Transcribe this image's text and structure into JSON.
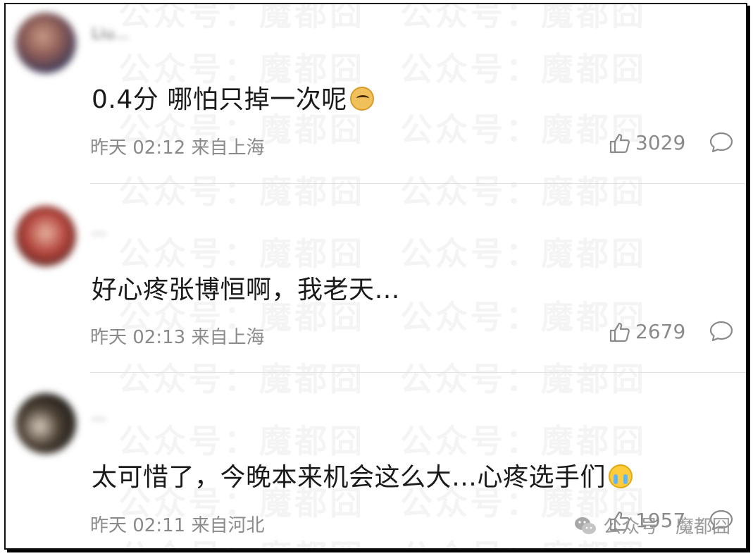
{
  "comments": [
    {
      "username": "Liu...",
      "text": "0.4分 哪怕只掉一次呢",
      "emoji": "sad-dog-emoji",
      "time": "昨天 02:12",
      "location": "来自上海",
      "likes": "3029"
    },
    {
      "username": "...",
      "text": "好心疼张博恒啊，我老天…",
      "emoji": "",
      "time": "昨天 02:13",
      "location": "来自上海",
      "likes": "2679"
    },
    {
      "username": "...",
      "text": "太可惜了，今晚本来机会这么大…心疼选手们",
      "emoji": "crying-emoji",
      "time": "昨天 02:11",
      "location": "来自河北",
      "likes": "1957"
    }
  ],
  "watermark": {
    "text": "公众号：魔都囧",
    "bottom_label": "公众号 · 魔都囧"
  },
  "colors": {
    "meta": "#8a8a8a",
    "text": "#1a1a1a",
    "divider": "#e1e1e1"
  }
}
